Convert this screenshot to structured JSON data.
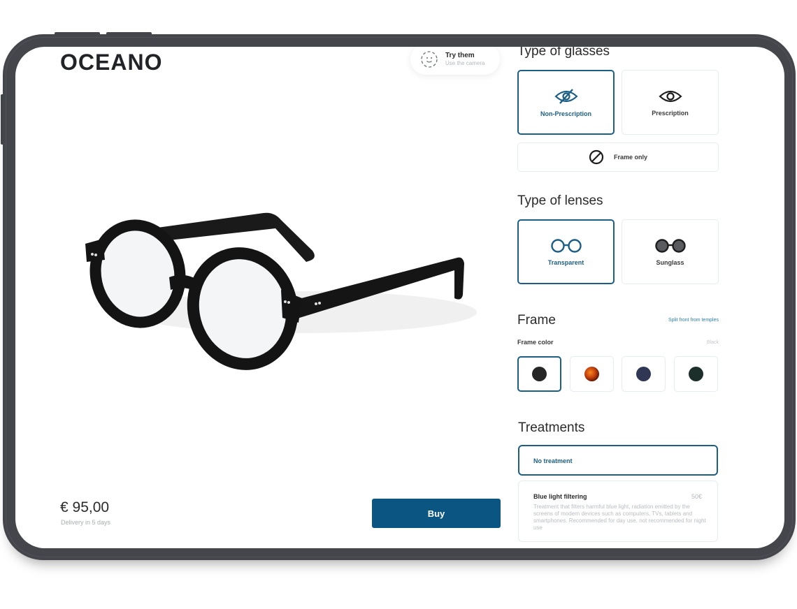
{
  "app": {
    "brand": "OCEANO"
  },
  "try_on": {
    "title": "Try them",
    "subtitle": "Use the camera",
    "icon": "face-scan-icon"
  },
  "product": {
    "image_alt": "Round black eyeglasses",
    "price": "€ 95,00",
    "delivery": "Delivery in 5 days",
    "buy_label": "Buy"
  },
  "glasses_type": {
    "title": "Type of glasses",
    "options": [
      {
        "label": "Non-Prescription",
        "icon": "eye-slash-icon",
        "selected": true
      },
      {
        "label": "Prescription",
        "icon": "eye-icon",
        "selected": false
      },
      {
        "label": "Frame only",
        "icon": "prohibited-icon",
        "selected": false
      }
    ]
  },
  "lens_type": {
    "title": "Type of lenses",
    "options": [
      {
        "label": "Transparent",
        "icon": "transparent-glasses-icon",
        "selected": true
      },
      {
        "label": "Sunglass",
        "icon": "sunglasses-icon",
        "selected": false
      }
    ]
  },
  "frame": {
    "title": "Frame",
    "split_link": "Split front from temples",
    "color_label": "Frame color",
    "color_value": "Black",
    "colors": [
      {
        "name": "Black",
        "hex": "#262626",
        "selected": true
      },
      {
        "name": "Tortoise",
        "hex": "#b8430f",
        "selected": false
      },
      {
        "name": "Navy",
        "hex": "#2f3755",
        "selected": false
      },
      {
        "name": "Dark green",
        "hex": "#1c2f2b",
        "selected": false
      }
    ]
  },
  "treatments": {
    "title": "Treatments",
    "options": [
      {
        "name": "No treatment",
        "selected": true
      },
      {
        "name": "Blue light filtering",
        "price": "50€",
        "description": "Treatment that filters harmful blue light, radiation emitted by the screens of modern devices such as computers, TVs, tablets and smartphones. Recommended for day use, not recommended for night use",
        "selected": false
      }
    ]
  },
  "colors": {
    "accent": "#1d5e85",
    "buy_button": "#0b5582",
    "device_bezel": "#44464c"
  }
}
